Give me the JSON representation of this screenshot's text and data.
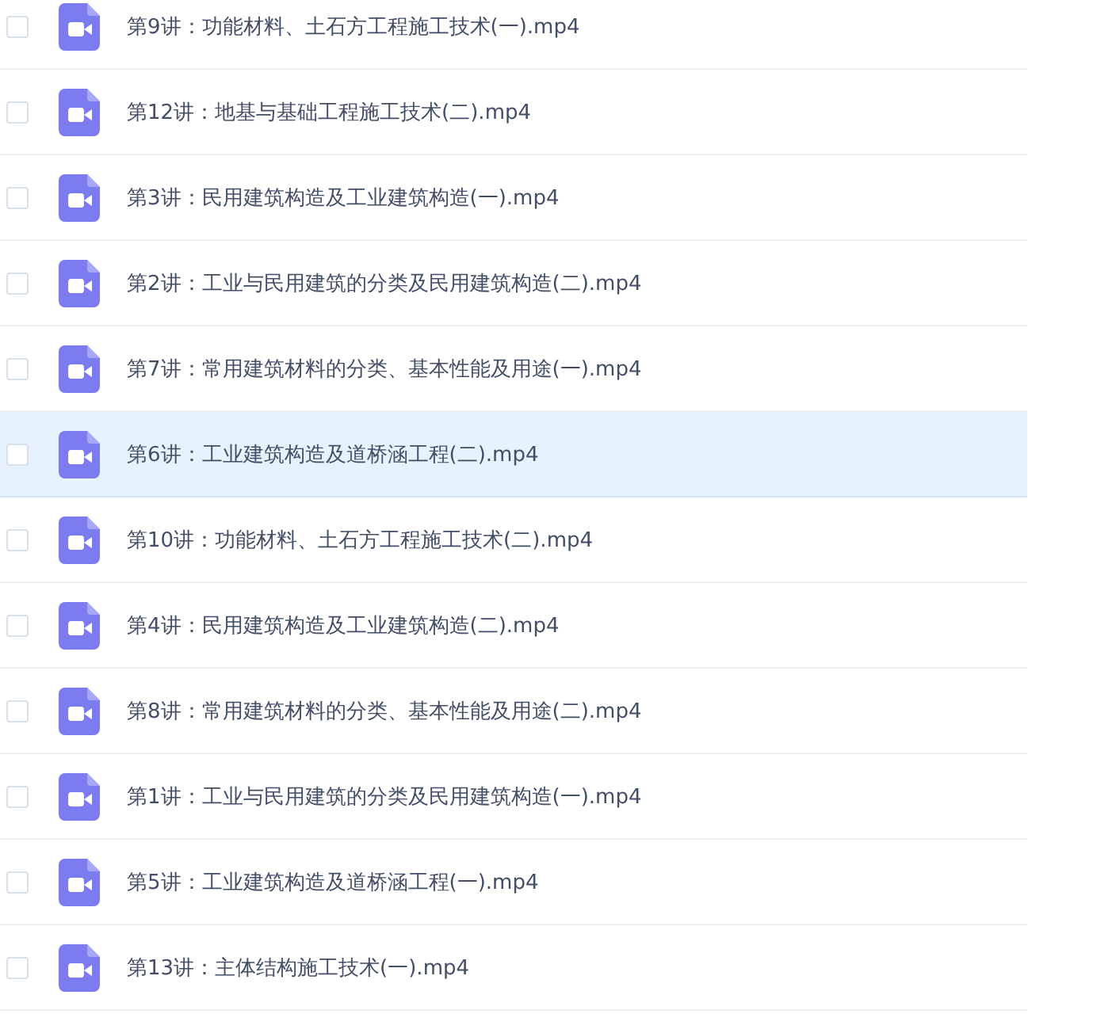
{
  "files": [
    {
      "name": "第9讲：功能材料、土石方工程施工技术(一).mp4",
      "checked": false,
      "selected": false
    },
    {
      "name": "第12讲：地基与基础工程施工技术(二).mp4",
      "checked": false,
      "selected": false
    },
    {
      "name": "第3讲：民用建筑构造及工业建筑构造(一).mp4",
      "checked": false,
      "selected": false
    },
    {
      "name": "第2讲：工业与民用建筑的分类及民用建筑构造(二).mp4",
      "checked": false,
      "selected": false
    },
    {
      "name": "第7讲：常用建筑材料的分类、基本性能及用途(一).mp4",
      "checked": false,
      "selected": false
    },
    {
      "name": "第6讲：工业建筑构造及道桥涵工程(二).mp4",
      "checked": false,
      "selected": true
    },
    {
      "name": "第10讲：功能材料、土石方工程施工技术(二).mp4",
      "checked": false,
      "selected": false
    },
    {
      "name": "第4讲：民用建筑构造及工业建筑构造(二).mp4",
      "checked": false,
      "selected": false
    },
    {
      "name": "第8讲：常用建筑材料的分类、基本性能及用途(二).mp4",
      "checked": false,
      "selected": false
    },
    {
      "name": "第1讲：工业与民用建筑的分类及民用建筑构造(一).mp4",
      "checked": false,
      "selected": false
    },
    {
      "name": "第5讲：工业建筑构造及道桥涵工程(一).mp4",
      "checked": false,
      "selected": false
    },
    {
      "name": "第13讲：主体结构施工技术(一).mp4",
      "checked": false,
      "selected": false
    }
  ]
}
